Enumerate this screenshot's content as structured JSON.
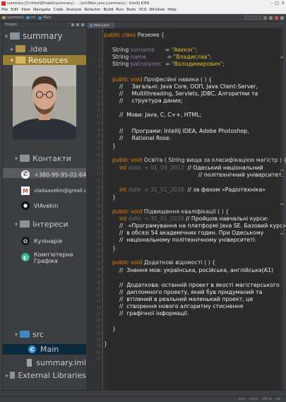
{
  "window": {
    "title": "summary [D:\\IntelliJProjekt\\summary] - ...\\src\\Main.java [summary] - IntelliJ IDEA",
    "controls": [
      "–",
      "□",
      "×"
    ]
  },
  "menu": [
    "File",
    "Edit",
    "View",
    "Navigate",
    "Code",
    "Analyze",
    "Refactor",
    "Build",
    "Run",
    "Tools",
    "VCS",
    "Window",
    "Help"
  ],
  "navbar": {
    "breadcrumbs": [
      "summary",
      "src",
      "Main"
    ]
  },
  "project_panel": {
    "header": "Project",
    "tree": {
      "root": "summary",
      "idea": ".idea",
      "resources": "Resources",
      "contacts": "Контакти",
      "interests": "Інтереси",
      "src": "src",
      "main": "Main",
      "iml": "summary.iml",
      "ext_libs": "External Libraries"
    },
    "contacts": {
      "phone": "+380-99-95-01-642",
      "email": "vladaavekin@gmail.com",
      "github": "VlAvekin"
    },
    "interests": {
      "cooking": "Кулінарія",
      "graphics_line1": "Комп'ютерна",
      "graphics_line2": "Графіка"
    }
  },
  "editor": {
    "tab": "Main.java",
    "code": {
      "l_class_kw": "public class ",
      "l_class_name": "Резюме {",
      "surname_type": "String ",
      "surname_field": "surname",
      "surname_eq": "      = ",
      "surname_val": "\"Авєкін\";",
      "name_type": "String ",
      "name_field": "name",
      "name_eq": "            = ",
      "name_val": "\"Владислав\";",
      "patr_type": "String ",
      "patr_field": "patronymic",
      "patr_eq": "  = ",
      "patr_val": "\"Володимирович\";",
      "m1_kw": "public void ",
      "m1_name": "Професійні навики ( ) {",
      "m1_c1": "//     Загальні: Java Core, ООП, Java Client-Server,",
      "m1_c2": "//     Multithreading, Servlets, JDBC, Алгоритми та",
      "m1_c3": "//     структура даних;",
      "m1_c4": "//  Мови: Java, C, C++, HTML;",
      "m1_c5": "//     Програми: IntelliJ IDEA, Adobe Photoshop,",
      "m1_c6": "//     Rational Rose.",
      "close": "}",
      "m2_kw": "public void ",
      "m2_name": "Освіта ( String вища за класифікацією магістр ) {",
      "m2_d1_kw": "int ",
      "m2_d1_rest": "date  = 01_09_2012  ",
      "m2_d1_c": "// Одеський національний",
      "m2_d1_c2": "// політехнічний університет.",
      "m2_d2_kw": "int ",
      "m2_d2_rest": "date  = 31_01_2018  ",
      "m2_d2_c": "// за фахом «Радіотехніка»",
      "m3_kw": "public void ",
      "m3_name": "Підвищення кваліфікації ( ) {",
      "m3_d_kw": "int ",
      "m3_d_rest": "date  = 31_01_2018 ",
      "m3_c1": "// Пройшов навчальні курси:",
      "m3_c2": "//   «Програмування на платформі Java SE. Базовий курс»,",
      "m3_c3": "//  в обсязі 54 академічних годин. При Одеському",
      "m3_c4": "//  національному політехнічному університеті.",
      "m4_kw": "public void ",
      "m4_name": "Додаткові відомості ( ) {",
      "m4_c1": "//  Знання мов: українська, російська, англійська(A1)",
      "m4_c2": "//  Додаткова: останній проект в якості магістерського",
      "m4_c3": "//  дипломного проекту, який був придуманий та",
      "m4_c4": "//  втілений в реальний маленький проект, це",
      "m4_c5": "//  створення нового алгоритму стиснення",
      "m4_c6": "//  графічної інформації."
    }
  },
  "statusbar": [
    "34:1",
    "CRLF",
    "UTF-8",
    "Git"
  ]
}
